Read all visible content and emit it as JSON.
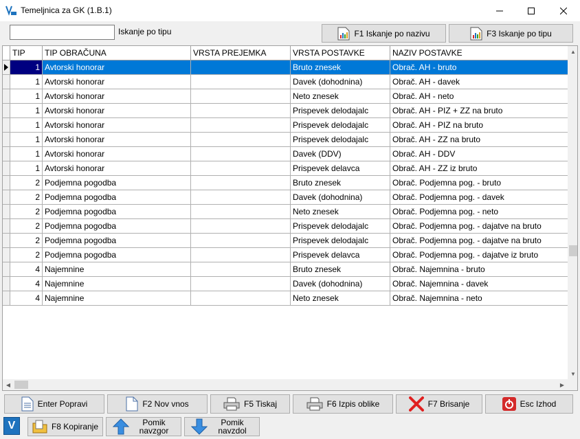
{
  "window": {
    "title": "Temeljnica za GK  (1.B.1)"
  },
  "search": {
    "value": "",
    "label": "Iskanje po tipu"
  },
  "top_buttons": {
    "f1": "F1 Iskanje po nazivu",
    "f3": "F3 Iskanje po tipu"
  },
  "table": {
    "columns": [
      "TIP",
      "TIP OBRAČUNA",
      "VRSTA PREJEMKA",
      "VRSTA POSTAVKE",
      "NAZIV POSTAVKE"
    ],
    "rows": [
      [
        "1",
        "Avtorski honorar",
        "",
        "Bruto znesek",
        "Obrač. AH - bruto"
      ],
      [
        "1",
        "Avtorski honorar",
        "",
        "Davek (dohodnina)",
        "Obrač. AH - davek"
      ],
      [
        "1",
        "Avtorski honorar",
        "",
        "Neto znesek",
        "Obrač. AH - neto"
      ],
      [
        "1",
        "Avtorski honorar",
        "",
        "Prispevek delodajalc",
        "Obrač. AH - PIZ + ZZ na bruto"
      ],
      [
        "1",
        "Avtorski honorar",
        "",
        "Prispevek delodajalc",
        "Obrač. AH - PIZ na bruto"
      ],
      [
        "1",
        "Avtorski honorar",
        "",
        "Prispevek delodajalc",
        "Obrač. AH - ZZ na bruto"
      ],
      [
        "1",
        "Avtorski honorar",
        "",
        "Davek (DDV)",
        "Obrač. AH - DDV"
      ],
      [
        "1",
        "Avtorski honorar",
        "",
        "Prispevek delavca",
        "Obrač. AH - ZZ iz bruto"
      ],
      [
        "2",
        "Podjemna pogodba",
        "",
        "Bruto znesek",
        "Obrač. Podjemna pog. - bruto"
      ],
      [
        "2",
        "Podjemna pogodba",
        "",
        "Davek (dohodnina)",
        "Obrač. Podjemna pog. - davek"
      ],
      [
        "2",
        "Podjemna pogodba",
        "",
        "Neto znesek",
        "Obrač. Podjemna pog. - neto"
      ],
      [
        "2",
        "Podjemna pogodba",
        "",
        "Prispevek delodajalc",
        "Obrač. Podjemna pog. - dajatve na bruto"
      ],
      [
        "2",
        "Podjemna pogodba",
        "",
        "Prispevek delodajalc",
        "Obrač. Podjemna pog. - dajatve na bruto"
      ],
      [
        "2",
        "Podjemna pogodba",
        "",
        "Prispevek delavca",
        "Obrač. Podjemna pog. - dajatve iz bruto"
      ],
      [
        "4",
        "Najemnine",
        "",
        "Bruto znesek",
        "Obrač. Najemnina - bruto"
      ],
      [
        "4",
        "Najemnine",
        "",
        "Davek (dohodnina)",
        "Obrač. Najemnina - davek"
      ],
      [
        "4",
        "Najemnine",
        "",
        "Neto znesek",
        "Obrač. Najemnina - neto"
      ]
    ],
    "selected_row": 0
  },
  "bottom_buttons": {
    "enter": "Enter Popravi",
    "f2": "F2 Nov vnos",
    "f5": "F5 Tiskaj",
    "f6": "F6 Izpis oblike",
    "f7": "F7 Brisanje",
    "esc": "Esc Izhod",
    "f8": "F8 Kopiranje",
    "up": "Pomik navzgor",
    "down": "Pomik navzdol"
  },
  "app_badge": "V",
  "colors": {
    "selection": "#0078d7",
    "selected_indicator": "#000080",
    "accent_blue": "#1e73be",
    "delete_red": "#e02020",
    "exit_red": "#d42a2a"
  },
  "icons": {
    "app": "app-logo-icon",
    "minimize": "minimize-icon",
    "maximize": "maximize-icon",
    "close": "close-icon",
    "report": "report-chart-icon",
    "document": "document-icon",
    "printer": "printer-icon",
    "delete": "red-x-icon",
    "exit": "power-icon",
    "copy": "folder-copy-icon",
    "up": "arrow-up-icon",
    "down": "arrow-down-icon",
    "row_pointer": "row-pointer-icon"
  }
}
